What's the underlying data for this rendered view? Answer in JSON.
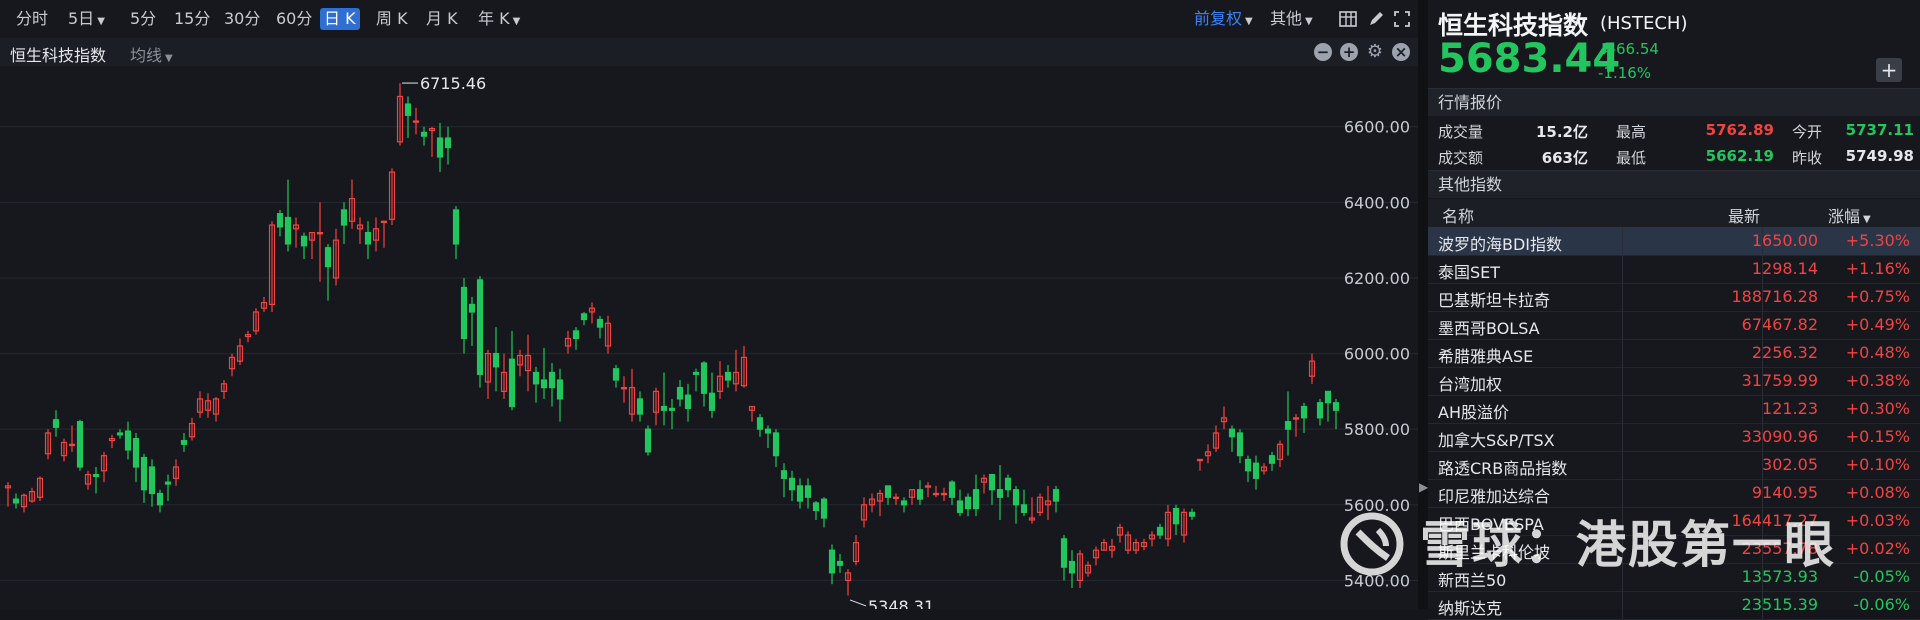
{
  "toolbar": {
    "periods": [
      "分时",
      "5日",
      "5分",
      "15分",
      "30分",
      "60分",
      "日 K",
      "周 K",
      "月 K",
      "年 K"
    ],
    "active_period": "日 K",
    "adjust_label": "前复权",
    "other_label": "其他"
  },
  "chart_header": {
    "title": "恒生科技指数",
    "ma_label": "均线"
  },
  "chart_data": {
    "type": "candlestick",
    "y_ticks": [
      "6600.00",
      "6400.00",
      "6200.00",
      "6000.00",
      "5800.00",
      "5600.00",
      "5400.00"
    ],
    "y_tick_values": [
      6600,
      6400,
      6200,
      6000,
      5800,
      5600,
      5400
    ],
    "ylim": [
      5335,
      6750
    ],
    "annotations": [
      {
        "label": "6715.46",
        "value": 6715.46
      },
      {
        "label": "5348.31",
        "value": 5348.31
      }
    ],
    "candles": [
      [
        5645,
        5650,
        5595,
        5660
      ],
      [
        5615,
        5605,
        5590,
        5630
      ],
      [
        5595,
        5625,
        5580,
        5630
      ],
      [
        5610,
        5635,
        5605,
        5645
      ],
      [
        5620,
        5670,
        5610,
        5675
      ],
      [
        5735,
        5790,
        5720,
        5800
      ],
      [
        5825,
        5805,
        5780,
        5850
      ],
      [
        5730,
        5765,
        5715,
        5775
      ],
      [
        5760,
        5760,
        5740,
        5810
      ],
      [
        5820,
        5700,
        5690,
        5825
      ],
      [
        5655,
        5680,
        5640,
        5690
      ],
      [
        5680,
        5675,
        5630,
        5700
      ],
      [
        5690,
        5730,
        5660,
        5740
      ],
      [
        5770,
        5775,
        5750,
        5785
      ],
      [
        5790,
        5785,
        5775,
        5800
      ],
      [
        5795,
        5745,
        5720,
        5820
      ],
      [
        5775,
        5700,
        5660,
        5790
      ],
      [
        5725,
        5640,
        5605,
        5735
      ],
      [
        5700,
        5630,
        5595,
        5720
      ],
      [
        5630,
        5600,
        5580,
        5640
      ],
      [
        5660,
        5655,
        5610,
        5680
      ],
      [
        5670,
        5700,
        5650,
        5720
      ],
      [
        5770,
        5760,
        5740,
        5790
      ],
      [
        5780,
        5815,
        5770,
        5830
      ],
      [
        5845,
        5880,
        5830,
        5900
      ],
      [
        5850,
        5875,
        5830,
        5895
      ],
      [
        5840,
        5880,
        5820,
        5885
      ],
      [
        5900,
        5920,
        5880,
        5930
      ],
      [
        5960,
        5990,
        5940,
        6000
      ],
      [
        5980,
        6020,
        5970,
        6040
      ],
      [
        6045,
        6050,
        6030,
        6060
      ],
      [
        6060,
        6110,
        6050,
        6120
      ],
      [
        6120,
        6135,
        6110,
        6150
      ],
      [
        6130,
        6340,
        6110,
        6350
      ],
      [
        6370,
        6335,
        6310,
        6380
      ],
      [
        6360,
        6290,
        6270,
        6460
      ],
      [
        6330,
        6340,
        6280,
        6360
      ],
      [
        6310,
        6285,
        6250,
        6320
      ],
      [
        6300,
        6320,
        6250,
        6320
      ],
      [
        6320,
        6320,
        6190,
        6400
      ],
      [
        6280,
        6230,
        6140,
        6290
      ],
      [
        6200,
        6300,
        6180,
        6330
      ],
      [
        6380,
        6340,
        6290,
        6400
      ],
      [
        6350,
        6410,
        6330,
        6460
      ],
      [
        6330,
        6340,
        6290,
        6360
      ],
      [
        6320,
        6290,
        6250,
        6350
      ],
      [
        6300,
        6330,
        6270,
        6360
      ],
      [
        6350,
        6350,
        6280,
        6350
      ],
      [
        6355,
        6480,
        6340,
        6490
      ],
      [
        6560,
        6680,
        6550,
        6715
      ],
      [
        6660,
        6630,
        6570,
        6680
      ],
      [
        6615,
        6615,
        6580,
        6650
      ],
      [
        6585,
        6575,
        6550,
        6600
      ],
      [
        6590,
        6595,
        6520,
        6600
      ],
      [
        6570,
        6520,
        6480,
        6610
      ],
      [
        6570,
        6545,
        6500,
        6600
      ],
      [
        6380,
        6290,
        6250,
        6390
      ],
      [
        6175,
        6040,
        6000,
        6200
      ],
      [
        6130,
        6110,
        6020,
        6150
      ],
      [
        6195,
        5945,
        5910,
        6205
      ],
      [
        5925,
        6000,
        5880,
        6010
      ],
      [
        6000,
        5965,
        5900,
        6070
      ],
      [
        5900,
        5950,
        5880,
        6000
      ],
      [
        5985,
        5860,
        5850,
        6060
      ],
      [
        5970,
        5995,
        5940,
        6010
      ],
      [
        5955,
        5995,
        5900,
        6050
      ],
      [
        5950,
        5920,
        5870,
        5965
      ],
      [
        5930,
        5910,
        5880,
        6015
      ],
      [
        5950,
        5910,
        5860,
        5975
      ],
      [
        5930,
        5880,
        5820,
        5960
      ],
      [
        6020,
        6040,
        6000,
        6060
      ],
      [
        6060,
        6040,
        6010,
        6070
      ],
      [
        6105,
        6090,
        6075,
        6110
      ],
      [
        6110,
        6120,
        6080,
        6135
      ],
      [
        6090,
        6070,
        6040,
        6100
      ],
      [
        6020,
        6080,
        6000,
        6100
      ],
      [
        5960,
        5930,
        5910,
        5970
      ],
      [
        5910,
        5910,
        5870,
        5940
      ],
      [
        5840,
        5910,
        5820,
        5960
      ],
      [
        5880,
        5840,
        5820,
        5900
      ],
      [
        5800,
        5740,
        5730,
        5810
      ],
      [
        5845,
        5900,
        5810,
        5910
      ],
      [
        5860,
        5850,
        5810,
        5950
      ],
      [
        5855,
        5850,
        5800,
        5880
      ],
      [
        5910,
        5880,
        5860,
        5930
      ],
      [
        5890,
        5855,
        5820,
        5920
      ],
      [
        5950,
        5945,
        5900,
        5960
      ],
      [
        5975,
        5895,
        5860,
        5980
      ],
      [
        5895,
        5850,
        5830,
        5950
      ],
      [
        5900,
        5940,
        5880,
        5980
      ],
      [
        5950,
        5930,
        5910,
        5970
      ],
      [
        5920,
        5950,
        5900,
        6010
      ],
      [
        5915,
        5990,
        5910,
        6020
      ],
      [
        5850,
        5860,
        5820,
        5860
      ],
      [
        5830,
        5800,
        5780,
        5840
      ],
      [
        5800,
        5790,
        5750,
        5810
      ],
      [
        5790,
        5730,
        5700,
        5800
      ],
      [
        5690,
        5670,
        5620,
        5710
      ],
      [
        5670,
        5640,
        5610,
        5690
      ],
      [
        5650,
        5610,
        5590,
        5670
      ],
      [
        5650,
        5620,
        5590,
        5670
      ],
      [
        5605,
        5585,
        5560,
        5610
      ],
      [
        5615,
        5565,
        5540,
        5620
      ],
      [
        5480,
        5420,
        5390,
        5495
      ],
      [
        5450,
        5440,
        5420,
        5470
      ],
      [
        5400,
        5420,
        5360,
        5430
      ],
      [
        5450,
        5500,
        5440,
        5520
      ],
      [
        5560,
        5600,
        5540,
        5620
      ],
      [
        5600,
        5615,
        5580,
        5630
      ],
      [
        5610,
        5630,
        5570,
        5640
      ],
      [
        5650,
        5620,
        5600,
        5650
      ],
      [
        5620,
        5620,
        5600,
        5630
      ],
      [
        5610,
        5600,
        5580,
        5620
      ],
      [
        5620,
        5640,
        5600,
        5640
      ],
      [
        5640,
        5615,
        5600,
        5665
      ],
      [
        5650,
        5650,
        5620,
        5660
      ],
      [
        5630,
        5630,
        5620,
        5650
      ],
      [
        5630,
        5630,
        5610,
        5645
      ],
      [
        5660,
        5620,
        5600,
        5665
      ],
      [
        5610,
        5580,
        5570,
        5640
      ],
      [
        5620,
        5590,
        5570,
        5630
      ],
      [
        5640,
        5590,
        5570,
        5680
      ],
      [
        5660,
        5670,
        5630,
        5680
      ],
      [
        5680,
        5640,
        5600,
        5680
      ],
      [
        5640,
        5620,
        5560,
        5705
      ],
      [
        5670,
        5640,
        5620,
        5680
      ],
      [
        5640,
        5600,
        5550,
        5650
      ],
      [
        5600,
        5580,
        5570,
        5640
      ],
      [
        5560,
        5565,
        5550,
        5620
      ],
      [
        5580,
        5620,
        5570,
        5630
      ],
      [
        5600,
        5610,
        5560,
        5650
      ],
      [
        5640,
        5610,
        5580,
        5650
      ],
      [
        5510,
        5435,
        5400,
        5520
      ],
      [
        5450,
        5420,
        5380,
        5480
      ],
      [
        5400,
        5470,
        5380,
        5480
      ],
      [
        5420,
        5440,
        5410,
        5450
      ],
      [
        5460,
        5480,
        5440,
        5490
      ],
      [
        5480,
        5500,
        5480,
        5510
      ],
      [
        5480,
        5490,
        5460,
        5510
      ],
      [
        5520,
        5540,
        5500,
        5550
      ],
      [
        5480,
        5520,
        5470,
        5530
      ],
      [
        5480,
        5500,
        5470,
        5510
      ],
      [
        5490,
        5500,
        5480,
        5510
      ],
      [
        5510,
        5520,
        5490,
        5530
      ],
      [
        5540,
        5520,
        5510,
        5550
      ],
      [
        5510,
        5580,
        5490,
        5600
      ],
      [
        5590,
        5550,
        5520,
        5600
      ],
      [
        5520,
        5580,
        5500,
        5590
      ],
      [
        5580,
        5570,
        5560,
        5590
      ],
      [
        5720,
        5720,
        5690,
        5720
      ],
      [
        5730,
        5740,
        5710,
        5760
      ],
      [
        5750,
        5790,
        5740,
        5810
      ],
      [
        5820,
        5830,
        5800,
        5860
      ],
      [
        5800,
        5780,
        5740,
        5810
      ],
      [
        5790,
        5730,
        5710,
        5800
      ],
      [
        5720,
        5690,
        5660,
        5730
      ],
      [
        5710,
        5670,
        5640,
        5730
      ],
      [
        5690,
        5700,
        5680,
        5710
      ],
      [
        5730,
        5710,
        5690,
        5740
      ],
      [
        5720,
        5760,
        5700,
        5770
      ],
      [
        5820,
        5800,
        5730,
        5900
      ],
      [
        5830,
        5830,
        5780,
        5840
      ],
      [
        5860,
        5830,
        5790,
        5870
      ],
      [
        5940,
        5980,
        5920,
        6000
      ],
      [
        5870,
        5830,
        5810,
        5880
      ],
      [
        5900,
        5870,
        5820,
        5900
      ],
      [
        5870,
        5850,
        5800,
        5880
      ]
    ]
  },
  "quote": {
    "name": "恒生科技指数",
    "code": "(HSTECH)",
    "price": "5683.44",
    "change": "-66.54",
    "change_pct": "-1.16%",
    "section_title": "行情报价",
    "items": [
      {
        "label": "成交量",
        "value": "15.2亿",
        "color": "white"
      },
      {
        "label": "最高",
        "value": "5762.89",
        "color": "red"
      },
      {
        "label": "今开",
        "value": "5737.11",
        "color": "green"
      },
      {
        "label": "成交额",
        "value": "663亿",
        "color": "white"
      },
      {
        "label": "最低",
        "value": "5662.19",
        "color": "green"
      },
      {
        "label": "昨收",
        "value": "5749.98",
        "color": "white"
      }
    ]
  },
  "other_indices": {
    "section_title": "其他指数",
    "headers": [
      "名称",
      "最新",
      "涨幅"
    ],
    "rows": [
      {
        "name": "波罗的海BDI指数",
        "price": "1650.00",
        "pct": "+5.30%",
        "color": "red"
      },
      {
        "name": "泰国SET",
        "price": "1298.14",
        "pct": "+1.16%",
        "color": "red"
      },
      {
        "name": "巴基斯坦卡拉奇",
        "price": "188716.28",
        "pct": "+0.75%",
        "color": "red"
      },
      {
        "name": "墨西哥BOLSA",
        "price": "67467.82",
        "pct": "+0.49%",
        "color": "red"
      },
      {
        "name": "希腊雅典ASE",
        "price": "2256.32",
        "pct": "+0.48%",
        "color": "red"
      },
      {
        "name": "台湾加权",
        "price": "31759.99",
        "pct": "+0.38%",
        "color": "red"
      },
      {
        "name": "AH股溢价",
        "price": "121.23",
        "pct": "+0.30%",
        "color": "red"
      },
      {
        "name": "加拿大S&P/TSX",
        "price": "33090.96",
        "pct": "+0.15%",
        "color": "red"
      },
      {
        "name": "路透CRB商品指数",
        "price": "302.05",
        "pct": "+0.10%",
        "color": "red"
      },
      {
        "name": "印尼雅加达综合",
        "price": "9140.95",
        "pct": "+0.08%",
        "color": "red"
      },
      {
        "name": "巴西BOVESPA",
        "price": "164417.27",
        "pct": "+0.03%",
        "color": "red"
      },
      {
        "name": "斯里兰卡科伦坡",
        "price": "23557.78",
        "pct": "+0.02%",
        "color": "red"
      },
      {
        "name": "新西兰50",
        "price": "13573.93",
        "pct": "-0.05%",
        "color": "green"
      },
      {
        "name": "纳斯达克",
        "price": "23515.39",
        "pct": "-0.06%",
        "color": "green"
      }
    ]
  },
  "watermark": "雪球：港股第一眼",
  "colors": {
    "up": "#ef4444",
    "down": "#22c55e",
    "accent": "#2f6fd1"
  }
}
